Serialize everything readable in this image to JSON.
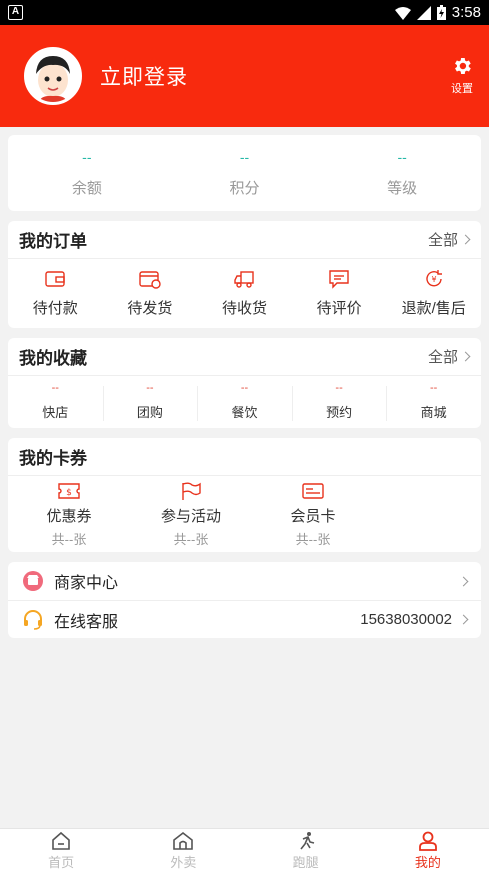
{
  "status_bar": {
    "time": "3:58"
  },
  "header": {
    "login_text": "立即登录",
    "settings_label": "设置"
  },
  "stats": [
    {
      "value": "--",
      "label": "余额"
    },
    {
      "value": "--",
      "label": "积分"
    },
    {
      "value": "--",
      "label": "等级"
    }
  ],
  "orders": {
    "title": "我的订单",
    "all_label": "全部",
    "items": [
      {
        "label": "待付款",
        "icon": "wallet-icon"
      },
      {
        "label": "待发货",
        "icon": "card-clock-icon"
      },
      {
        "label": "待收货",
        "icon": "truck-icon"
      },
      {
        "label": "待评价",
        "icon": "comment-icon"
      },
      {
        "label": "退款/售后",
        "icon": "refund-icon"
      }
    ]
  },
  "favorites": {
    "title": "我的收藏",
    "all_label": "全部",
    "items": [
      {
        "value": "--",
        "label": "快店"
      },
      {
        "value": "--",
        "label": "团购"
      },
      {
        "value": "--",
        "label": "餐饮"
      },
      {
        "value": "--",
        "label": "预约"
      },
      {
        "value": "--",
        "label": "商城"
      }
    ]
  },
  "coupons": {
    "title": "我的卡券",
    "items": [
      {
        "label": "优惠券",
        "count": "共--张",
        "icon": "coupon-icon"
      },
      {
        "label": "参与活动",
        "count": "共--张",
        "icon": "flag-icon"
      },
      {
        "label": "会员卡",
        "count": "共--张",
        "icon": "member-card-icon"
      }
    ]
  },
  "menu": [
    {
      "label": "商家中心",
      "extra": "",
      "icon": "shop-icon"
    },
    {
      "label": "在线客服",
      "extra": "15638030002",
      "icon": "headset-icon"
    }
  ],
  "tabbar": [
    {
      "label": "首页",
      "icon": "home-icon",
      "active": false
    },
    {
      "label": "外卖",
      "icon": "takeout-icon",
      "active": false
    },
    {
      "label": "跑腿",
      "icon": "runner-icon",
      "active": false
    },
    {
      "label": "我的",
      "icon": "user-icon",
      "active": true
    }
  ],
  "colors": {
    "brand_red": "#f82a0e",
    "stat_value": "#25b8a7",
    "icon_red": "#e8321c"
  }
}
